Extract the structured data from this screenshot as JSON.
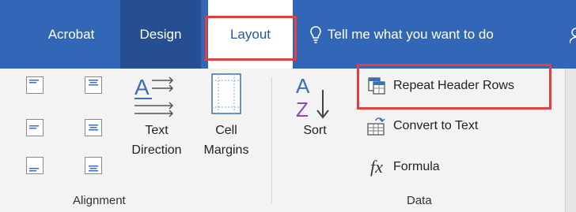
{
  "tabs": {
    "acrobat": "Acrobat",
    "design": "Design",
    "layout": "Layout"
  },
  "tell_me": "Tell me what you want to do",
  "groups": {
    "alignment": {
      "label": "Alignment",
      "text_direction": {
        "line1": "Text",
        "line2": "Direction"
      },
      "cell_margins": {
        "line1": "Cell",
        "line2": "Margins"
      }
    },
    "data": {
      "label": "Data",
      "sort": "Sort",
      "repeat_header_rows": "Repeat Header Rows",
      "convert_to_text": "Convert to Text",
      "formula": "Formula"
    }
  },
  "colors": {
    "ribbon_blue": "#3266b6",
    "highlight_red": "#e14040",
    "accent_blue": "#2b5798"
  }
}
